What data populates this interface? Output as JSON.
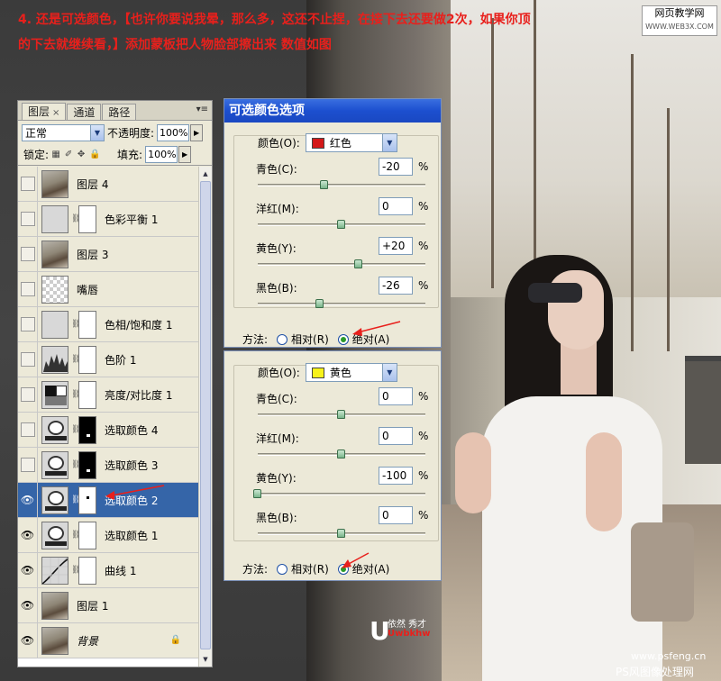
{
  "instruction": "4. 还是可选颜色，【也许你要说我晕，那么多，这还不止捏，在接下去还要做2次，如果你顶的下去就继续看，】添加蒙板把人物脸部擦出来 数值如图",
  "layers_panel": {
    "tabs": [
      "图层",
      "通道",
      "路径"
    ],
    "tab_close": "×",
    "menu_glyph": "▾≡",
    "blend_mode": "正常",
    "opacity_label": "不透明度:",
    "opacity_value": "100%",
    "lock_label": "锁定:",
    "lock_glyphs": [
      "▦",
      "✐",
      "✥",
      "🔒"
    ],
    "fill_label": "填充:",
    "fill_value": "100%",
    "layers": [
      {
        "name": "图层 4",
        "thumb": "photo",
        "mask": "none",
        "visible": false
      },
      {
        "name": "色彩平衡 1",
        "thumb": "adj-cb",
        "mask": "white",
        "visible": false
      },
      {
        "name": "图层 3",
        "thumb": "photo",
        "mask": "none",
        "visible": false
      },
      {
        "name": "嘴唇",
        "thumb": "checker",
        "mask": "none",
        "visible": false
      },
      {
        "name": "色相/饱和度 1",
        "thumb": "adj-hs",
        "mask": "white",
        "visible": false
      },
      {
        "name": "色阶 1",
        "thumb": "adj-lv",
        "mask": "white",
        "visible": false
      },
      {
        "name": "亮度/对比度 1",
        "thumb": "adj-bc",
        "mask": "white",
        "visible": false
      },
      {
        "name": "选取颜色 4",
        "thumb": "adj-sc",
        "mask": "black",
        "visible": false
      },
      {
        "name": "选取颜色 3",
        "thumb": "adj-sc",
        "mask": "black",
        "visible": false
      },
      {
        "name": "选取颜色 2",
        "thumb": "adj-sc",
        "mask": "white-spot",
        "visible": true,
        "selected": true
      },
      {
        "name": "选取颜色 1",
        "thumb": "adj-sc",
        "mask": "white",
        "visible": true
      },
      {
        "name": "曲线 1",
        "thumb": "adj-cv",
        "mask": "white",
        "visible": true
      },
      {
        "name": "图层 1",
        "thumb": "photo",
        "mask": "none",
        "visible": true
      },
      {
        "name": "背景",
        "thumb": "photo",
        "mask": "none",
        "visible": true,
        "locked": true
      }
    ]
  },
  "dialog1": {
    "title": "可选颜色选项",
    "color_label": "颜色(O):",
    "color_value": "红色",
    "color_hex": "#d41818",
    "sliders": [
      {
        "label": "青色(C):",
        "value": "-20",
        "pos": -20
      },
      {
        "label": "洋红(M):",
        "value": "0",
        "pos": 0
      },
      {
        "label": "黄色(Y):",
        "value": "+20",
        "pos": 20
      },
      {
        "label": "黑色(B):",
        "value": "-26",
        "pos": -26
      }
    ],
    "method_label": "方法:",
    "method_relative": "相对(R)",
    "method_absolute": "绝对(A)"
  },
  "dialog2": {
    "color_label": "颜色(O):",
    "color_value": "黄色",
    "color_hex": "#f7f21a",
    "sliders": [
      {
        "label": "青色(C):",
        "value": "0",
        "pos": 0
      },
      {
        "label": "洋红(M):",
        "value": "0",
        "pos": 0
      },
      {
        "label": "黄色(Y):",
        "value": "-100",
        "pos": -100
      },
      {
        "label": "黑色(B):",
        "value": "0",
        "pos": 0
      }
    ],
    "method_label": "方法:",
    "method_relative": "相对(R)",
    "method_absolute": "绝对(A)"
  },
  "percent": "%",
  "watermark_top": {
    "line1": "网页教学网",
    "line2": "WWW.WEB3X.COM"
  },
  "logo": {
    "mark": "U",
    "text1": "依然 秀才",
    "text2": "Uwbkhw"
  },
  "watermark_bottom": {
    "line1": "www.psfeng.cn",
    "line2": "PS风图像处理网"
  }
}
